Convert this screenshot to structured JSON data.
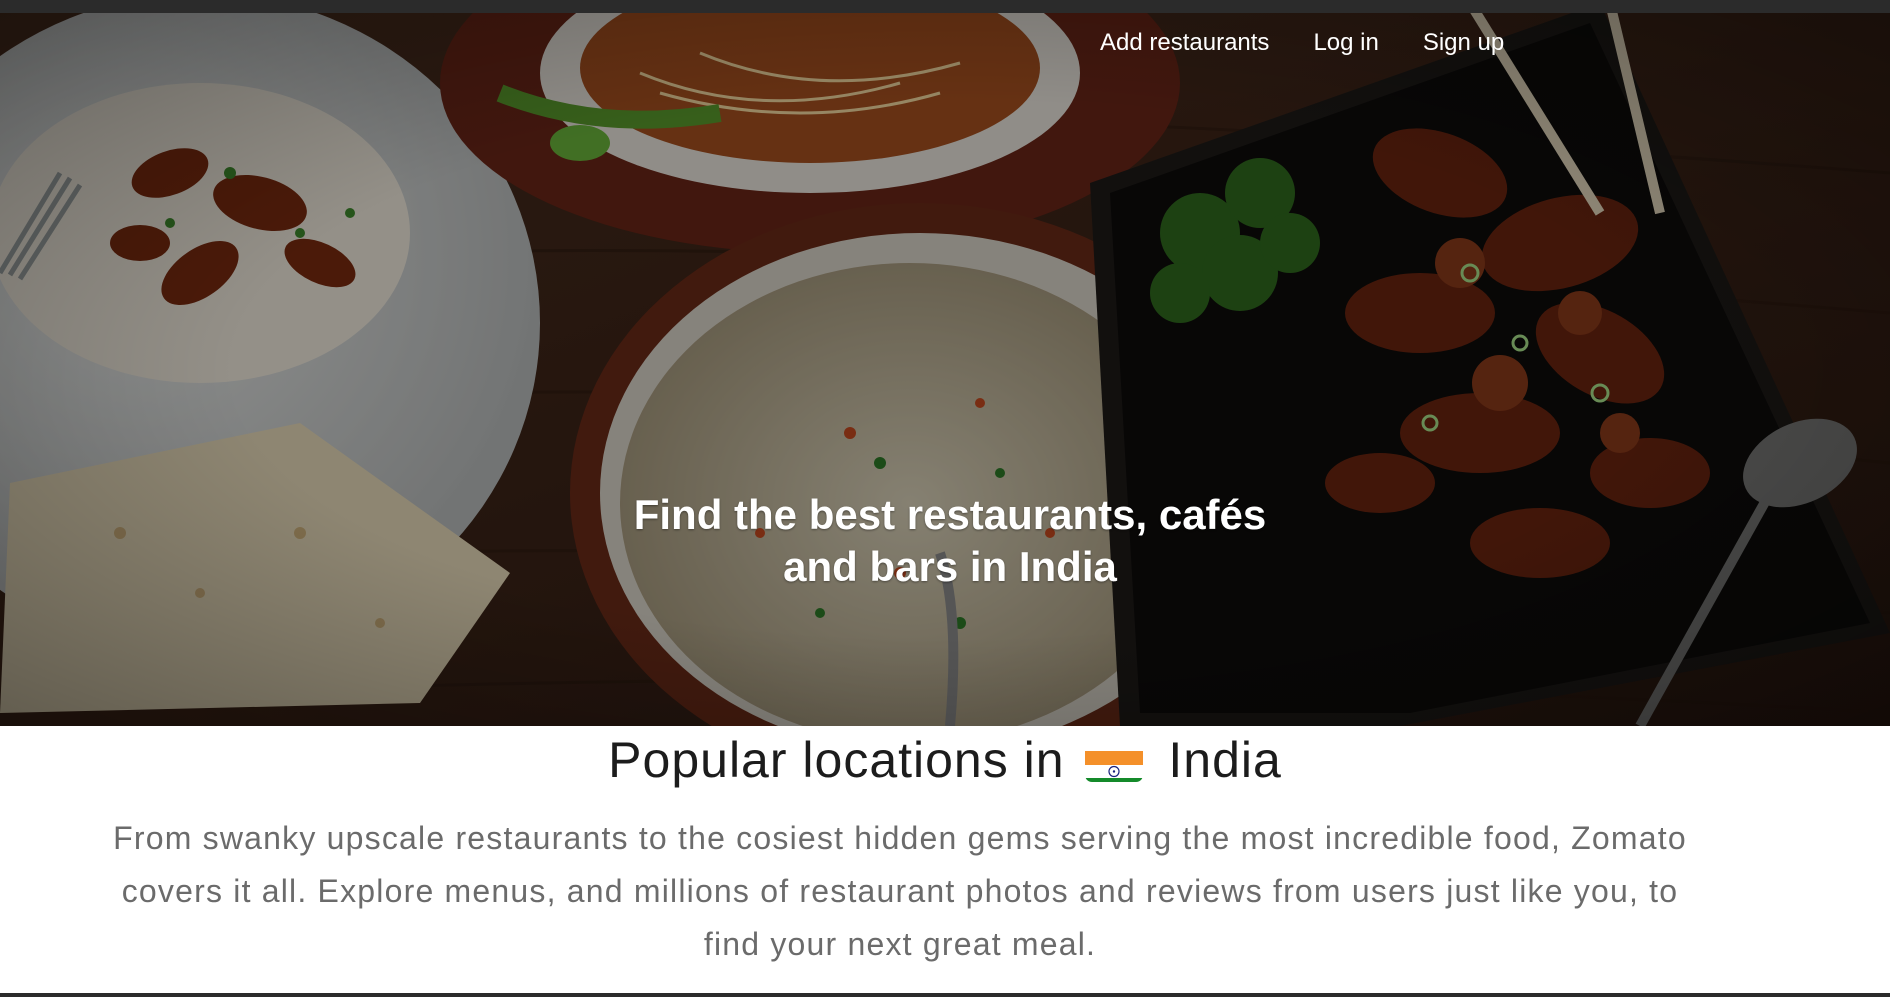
{
  "nav": {
    "links": [
      "Add restaurants",
      "Log in",
      "Sign up"
    ]
  },
  "hero": {
    "title_line1": "Find the best restaurants, cafés",
    "title_line2": "and bars in India"
  },
  "section": {
    "title_prefix": "Popular locations in",
    "flag_icon": "india-flag-icon",
    "country": "India",
    "description": "From swanky upscale restaurants to the cosiest hidden gems serving the most incredible food, Zomato covers it all. Explore menus, and millions of restaurant photos and reviews from users just like you, to find your next great meal."
  },
  "colors": {
    "flag_saffron": "#f4902a",
    "flag_white": "#ffffff",
    "flag_green": "#148a2a",
    "flag_chakra": "#1a237e"
  }
}
